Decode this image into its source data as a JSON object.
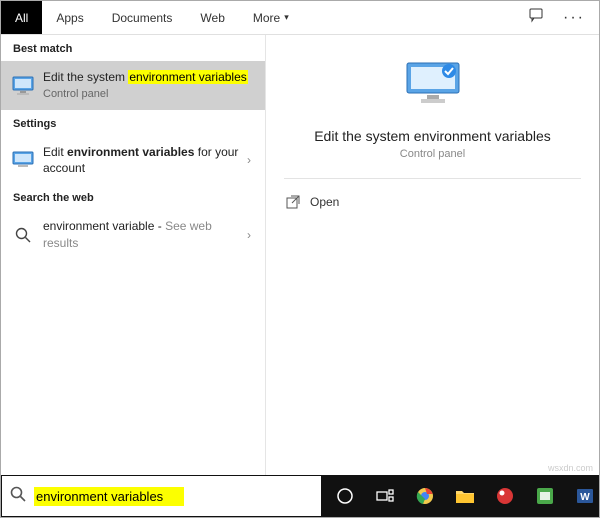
{
  "tabs": {
    "all": "All",
    "apps": "Apps",
    "documents": "Documents",
    "web": "Web",
    "more": "More"
  },
  "sections": {
    "best_match": "Best match",
    "settings": "Settings",
    "search_web": "Search the web"
  },
  "results": {
    "best": {
      "pre": "Edit the system ",
      "hl": "environment variables",
      "sub": "Control panel"
    },
    "setting": {
      "pre": "Edit ",
      "hl": "environment variables",
      "post": " for your account"
    },
    "web": {
      "term": "environment variable",
      "hint": "See web results"
    }
  },
  "preview": {
    "title": "Edit the system environment variables",
    "sub": "Control panel",
    "open": "Open"
  },
  "search": {
    "value": "environment variables"
  },
  "watermark": "wsxdn.com"
}
